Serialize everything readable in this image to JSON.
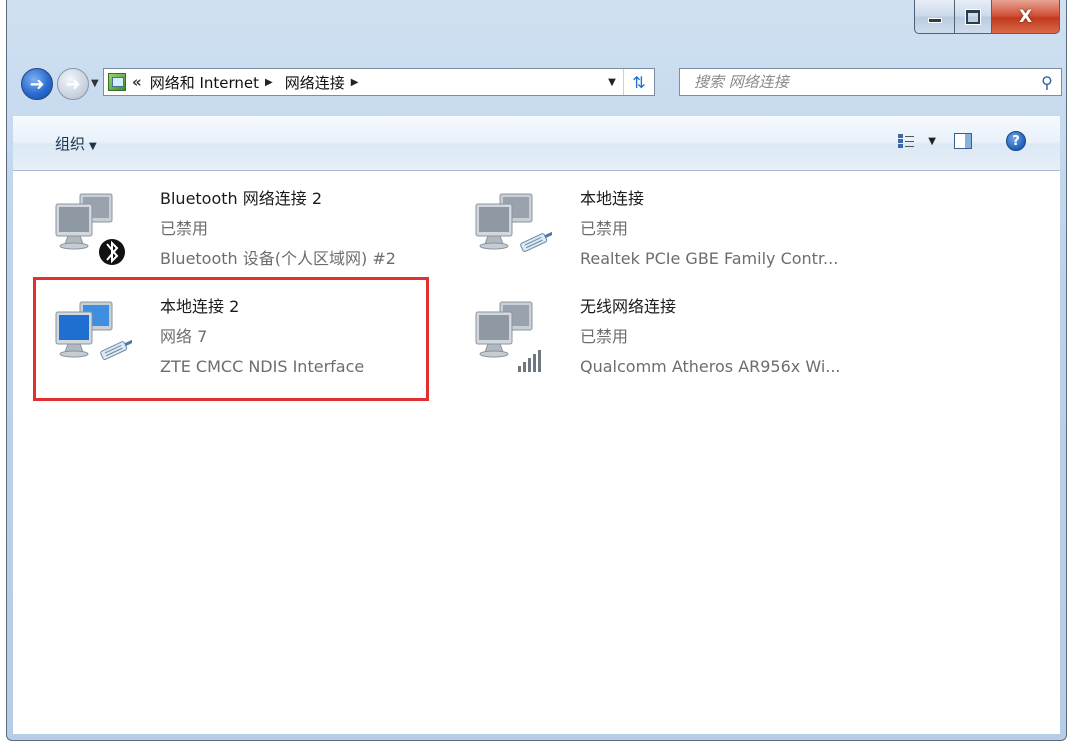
{
  "window": {
    "caption": {
      "minimize_icon": "minimize-icon",
      "maximize_icon": "maximize-icon",
      "close_label": "X"
    }
  },
  "navigation": {
    "address_overflow": "«",
    "breadcrumbs": [
      "网络和 Internet",
      "网络连接"
    ]
  },
  "search": {
    "placeholder": "搜索 网络连接"
  },
  "toolbar": {
    "organize_label": "组织"
  },
  "connections": [
    {
      "name": "Bluetooth 网络连接 2",
      "status": "已禁用",
      "device": "Bluetooth 设备(个人区域网) #2",
      "icon": "bluetooth-network-icon"
    },
    {
      "name": "本地连接",
      "status": "已禁用",
      "device": "Realtek PCIe GBE Family Contr...",
      "icon": "ethernet-network-icon"
    },
    {
      "name": "本地连接 2",
      "status": "网络  7",
      "device": "ZTE CMCC NDIS Interface",
      "icon": "ethernet-network-icon",
      "highlighted": true
    },
    {
      "name": "无线网络连接",
      "status": "已禁用",
      "device": "Qualcomm Atheros AR956x Wi...",
      "icon": "wireless-network-icon"
    }
  ],
  "colors": {
    "highlight_border": "#e03131",
    "status_text": "#6d6d6d"
  }
}
